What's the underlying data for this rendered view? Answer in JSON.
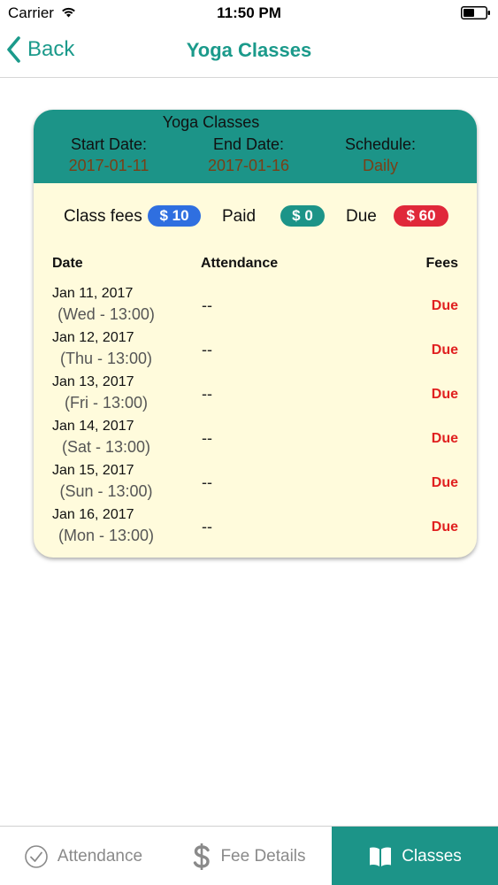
{
  "status_bar": {
    "carrier": "Carrier",
    "time": "11:50 PM"
  },
  "nav": {
    "back_label": "Back",
    "title": "Yoga Classes"
  },
  "card": {
    "title": "Yoga Classes",
    "start": {
      "label": "Start Date:",
      "value": "2017-01-11"
    },
    "end": {
      "label": "End Date:",
      "value": "2017-01-16"
    },
    "schedule": {
      "label": "Schedule:",
      "value": "Daily"
    },
    "fees": {
      "class_fees_label": "Class fees",
      "class_fees_value": "$ 10",
      "paid_label": "Paid",
      "paid_value": "$ 0",
      "due_label": "Due",
      "due_value": "$ 60"
    },
    "columns": {
      "date": "Date",
      "attendance": "Attendance",
      "fees": "Fees"
    },
    "rows": [
      {
        "date": "Jan 11, 2017",
        "time": "(Wed - 13:00)",
        "attendance": "--",
        "fee": "Due"
      },
      {
        "date": "Jan 12, 2017",
        "time": "(Thu - 13:00)",
        "attendance": "--",
        "fee": "Due"
      },
      {
        "date": "Jan 13, 2017",
        "time": "(Fri - 13:00)",
        "attendance": "--",
        "fee": "Due"
      },
      {
        "date": "Jan 14, 2017",
        "time": "(Sat - 13:00)",
        "attendance": "--",
        "fee": "Due"
      },
      {
        "date": "Jan 15, 2017",
        "time": "(Sun - 13:00)",
        "attendance": "--",
        "fee": "Due"
      },
      {
        "date": "Jan 16, 2017",
        "time": "(Mon - 13:00)",
        "attendance": "--",
        "fee": "Due"
      }
    ]
  },
  "tabs": [
    {
      "label": "Attendance",
      "icon": "check-circle-icon",
      "active": false
    },
    {
      "label": "Fee Details",
      "icon": "dollar-icon",
      "active": false
    },
    {
      "label": "Classes",
      "icon": "book-icon",
      "active": true
    }
  ],
  "colors": {
    "accent": "#1b9a8b",
    "header_bg": "#1c9488",
    "card_bg": "#fffbdc",
    "class_fee_badge": "#2f6fe0",
    "paid_badge": "#1c9488",
    "due_badge": "#e0283a",
    "due_text": "#e02020"
  }
}
